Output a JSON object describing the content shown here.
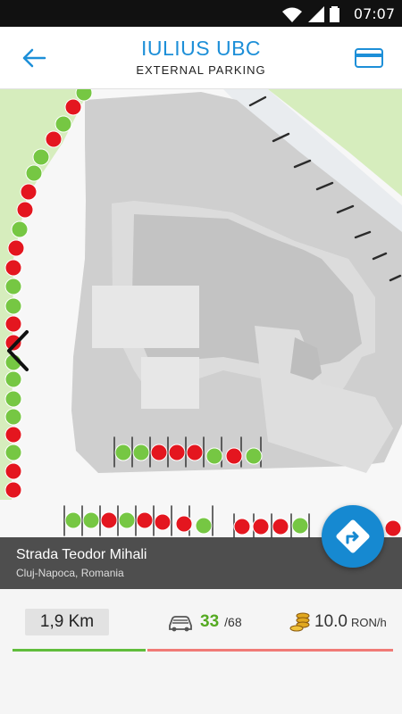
{
  "status_bar": {
    "time": "07:07"
  },
  "header": {
    "title": "IULIUS UBC",
    "subtitle": "EXTERNAL PARKING",
    "back_icon": "arrow-left-icon",
    "card_icon": "credit-card-icon"
  },
  "location": {
    "street": "Strada Teodor Mihali",
    "city": "Cluj-Napoca, Romania"
  },
  "stats": {
    "distance": "1,9 Km",
    "free_spots": "33",
    "total_spots": "/68",
    "price": "10.0",
    "price_unit": "RON/h",
    "occupancy": 0.35
  },
  "colors": {
    "accent": "#1d8fd8",
    "free_spot": "#76c743",
    "occupied_spot": "#e4161f",
    "map_building": "#cccccc",
    "map_green": "#cfe8b5"
  }
}
